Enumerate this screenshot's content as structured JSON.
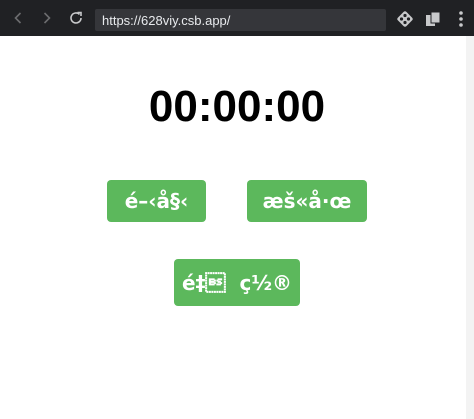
{
  "browser": {
    "url": "https://628viy.csb.app/",
    "icons": {
      "back": "arrow-left-icon",
      "forward": "arrow-right-icon",
      "reload": "reload-icon",
      "extension": "extension-icon",
      "tabs": "tabs-icon",
      "menu": "more-vert-icon"
    },
    "colors": {
      "toolbar": "#202124",
      "urlbar": "#35363a",
      "text": "#e8eaed"
    }
  },
  "timer": {
    "display": "00:00:00"
  },
  "buttons": {
    "start_label": "é–‹å§‹",
    "stop_label": "æš«å·œ",
    "reset_label": "é‡\b  ç½®"
  },
  "colors": {
    "button_bg": "#5cb85c",
    "button_text": "#ffffff"
  }
}
